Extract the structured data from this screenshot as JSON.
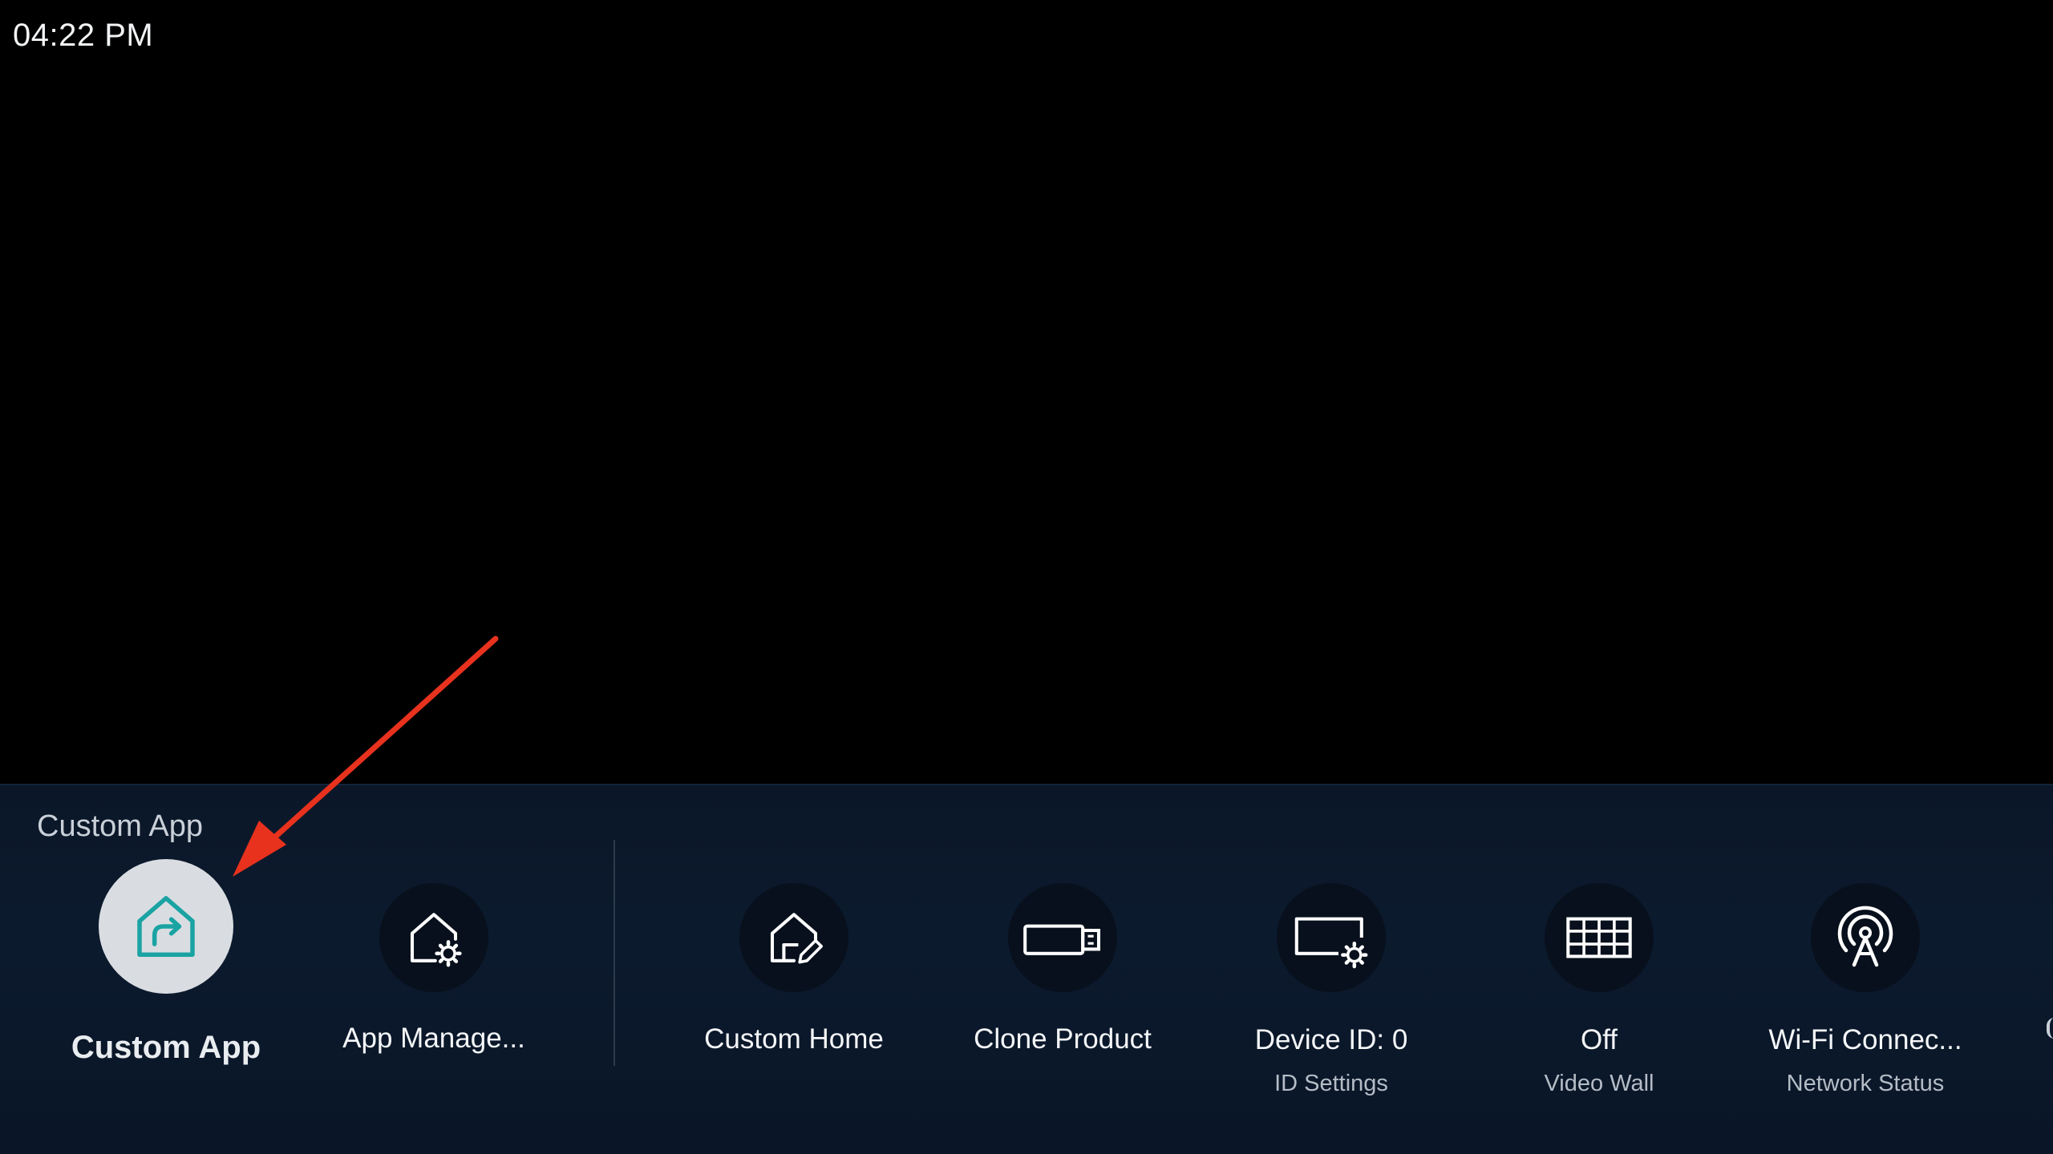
{
  "status_bar": {
    "clock": "04:22 PM"
  },
  "panel": {
    "section_label": "Custom App",
    "items": [
      {
        "label": "Custom App",
        "sublabel": "",
        "icon": "custom-app-home-arrow-icon",
        "focused": true
      },
      {
        "label": "App Manage...",
        "sublabel": "",
        "icon": "app-manager-home-gear-icon",
        "focused": false
      },
      {
        "label": "Custom Home",
        "sublabel": "",
        "icon": "custom-home-edit-icon",
        "focused": false
      },
      {
        "label": "Clone Product",
        "sublabel": "",
        "icon": "usb-drive-icon",
        "focused": false
      },
      {
        "label": "Device ID: 0",
        "sublabel": "ID Settings",
        "icon": "monitor-gear-icon",
        "focused": false
      },
      {
        "label": "Off",
        "sublabel": "Video Wall",
        "icon": "grid-icon",
        "focused": false
      },
      {
        "label": "Wi-Fi Connec...",
        "sublabel": "Network Status",
        "icon": "wifi-antenna-icon",
        "focused": false
      }
    ]
  },
  "colors": {
    "background": "#000000",
    "panel": "#0c1a2e",
    "focus_circle": "#d9dde1",
    "focus_icon": "#1aa3a3",
    "annotation_arrow": "#e8321e"
  }
}
